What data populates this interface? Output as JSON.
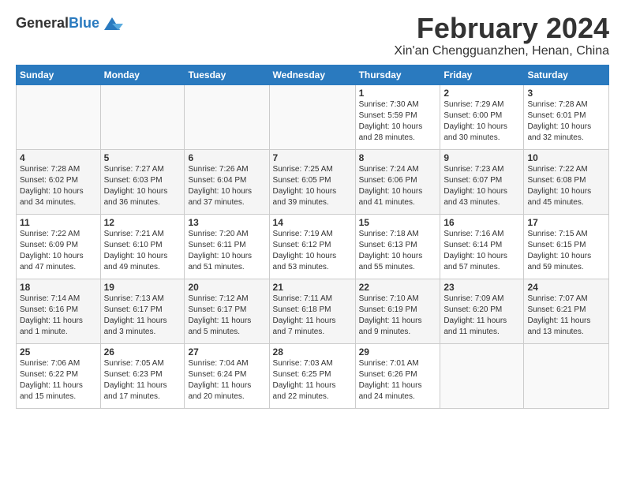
{
  "logo": {
    "general": "General",
    "blue": "Blue"
  },
  "header": {
    "month": "February 2024",
    "location": "Xin'an Chengguanzhen, Henan, China"
  },
  "weekdays": [
    "Sunday",
    "Monday",
    "Tuesday",
    "Wednesday",
    "Thursday",
    "Friday",
    "Saturday"
  ],
  "rows": [
    [
      {
        "day": "",
        "info": ""
      },
      {
        "day": "",
        "info": ""
      },
      {
        "day": "",
        "info": ""
      },
      {
        "day": "",
        "info": ""
      },
      {
        "day": "1",
        "info": "Sunrise: 7:30 AM\nSunset: 5:59 PM\nDaylight: 10 hours\nand 28 minutes."
      },
      {
        "day": "2",
        "info": "Sunrise: 7:29 AM\nSunset: 6:00 PM\nDaylight: 10 hours\nand 30 minutes."
      },
      {
        "day": "3",
        "info": "Sunrise: 7:28 AM\nSunset: 6:01 PM\nDaylight: 10 hours\nand 32 minutes."
      }
    ],
    [
      {
        "day": "4",
        "info": "Sunrise: 7:28 AM\nSunset: 6:02 PM\nDaylight: 10 hours\nand 34 minutes."
      },
      {
        "day": "5",
        "info": "Sunrise: 7:27 AM\nSunset: 6:03 PM\nDaylight: 10 hours\nand 36 minutes."
      },
      {
        "day": "6",
        "info": "Sunrise: 7:26 AM\nSunset: 6:04 PM\nDaylight: 10 hours\nand 37 minutes."
      },
      {
        "day": "7",
        "info": "Sunrise: 7:25 AM\nSunset: 6:05 PM\nDaylight: 10 hours\nand 39 minutes."
      },
      {
        "day": "8",
        "info": "Sunrise: 7:24 AM\nSunset: 6:06 PM\nDaylight: 10 hours\nand 41 minutes."
      },
      {
        "day": "9",
        "info": "Sunrise: 7:23 AM\nSunset: 6:07 PM\nDaylight: 10 hours\nand 43 minutes."
      },
      {
        "day": "10",
        "info": "Sunrise: 7:22 AM\nSunset: 6:08 PM\nDaylight: 10 hours\nand 45 minutes."
      }
    ],
    [
      {
        "day": "11",
        "info": "Sunrise: 7:22 AM\nSunset: 6:09 PM\nDaylight: 10 hours\nand 47 minutes."
      },
      {
        "day": "12",
        "info": "Sunrise: 7:21 AM\nSunset: 6:10 PM\nDaylight: 10 hours\nand 49 minutes."
      },
      {
        "day": "13",
        "info": "Sunrise: 7:20 AM\nSunset: 6:11 PM\nDaylight: 10 hours\nand 51 minutes."
      },
      {
        "day": "14",
        "info": "Sunrise: 7:19 AM\nSunset: 6:12 PM\nDaylight: 10 hours\nand 53 minutes."
      },
      {
        "day": "15",
        "info": "Sunrise: 7:18 AM\nSunset: 6:13 PM\nDaylight: 10 hours\nand 55 minutes."
      },
      {
        "day": "16",
        "info": "Sunrise: 7:16 AM\nSunset: 6:14 PM\nDaylight: 10 hours\nand 57 minutes."
      },
      {
        "day": "17",
        "info": "Sunrise: 7:15 AM\nSunset: 6:15 PM\nDaylight: 10 hours\nand 59 minutes."
      }
    ],
    [
      {
        "day": "18",
        "info": "Sunrise: 7:14 AM\nSunset: 6:16 PM\nDaylight: 11 hours\nand 1 minute."
      },
      {
        "day": "19",
        "info": "Sunrise: 7:13 AM\nSunset: 6:17 PM\nDaylight: 11 hours\nand 3 minutes."
      },
      {
        "day": "20",
        "info": "Sunrise: 7:12 AM\nSunset: 6:17 PM\nDaylight: 11 hours\nand 5 minutes."
      },
      {
        "day": "21",
        "info": "Sunrise: 7:11 AM\nSunset: 6:18 PM\nDaylight: 11 hours\nand 7 minutes."
      },
      {
        "day": "22",
        "info": "Sunrise: 7:10 AM\nSunset: 6:19 PM\nDaylight: 11 hours\nand 9 minutes."
      },
      {
        "day": "23",
        "info": "Sunrise: 7:09 AM\nSunset: 6:20 PM\nDaylight: 11 hours\nand 11 minutes."
      },
      {
        "day": "24",
        "info": "Sunrise: 7:07 AM\nSunset: 6:21 PM\nDaylight: 11 hours\nand 13 minutes."
      }
    ],
    [
      {
        "day": "25",
        "info": "Sunrise: 7:06 AM\nSunset: 6:22 PM\nDaylight: 11 hours\nand 15 minutes."
      },
      {
        "day": "26",
        "info": "Sunrise: 7:05 AM\nSunset: 6:23 PM\nDaylight: 11 hours\nand 17 minutes."
      },
      {
        "day": "27",
        "info": "Sunrise: 7:04 AM\nSunset: 6:24 PM\nDaylight: 11 hours\nand 20 minutes."
      },
      {
        "day": "28",
        "info": "Sunrise: 7:03 AM\nSunset: 6:25 PM\nDaylight: 11 hours\nand 22 minutes."
      },
      {
        "day": "29",
        "info": "Sunrise: 7:01 AM\nSunset: 6:26 PM\nDaylight: 11 hours\nand 24 minutes."
      },
      {
        "day": "",
        "info": ""
      },
      {
        "day": "",
        "info": ""
      }
    ]
  ]
}
